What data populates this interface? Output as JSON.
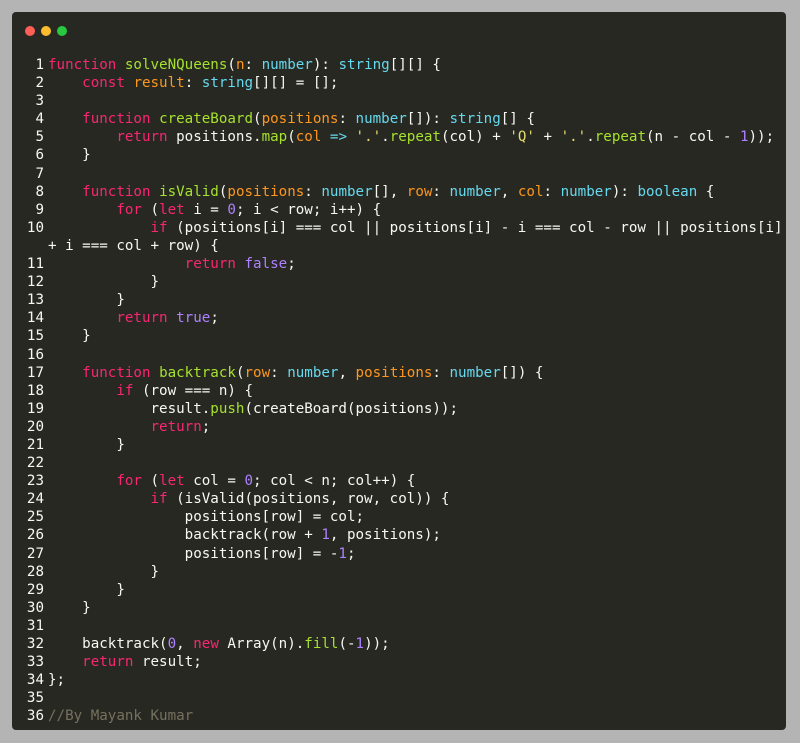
{
  "window": {
    "controls": [
      "close",
      "minimize",
      "maximize"
    ],
    "language": "typescript"
  },
  "colors": {
    "background": "#272822",
    "keyword": "#f92672",
    "function": "#a6e22e",
    "type": "#66d9ef",
    "parameter": "#fd971f",
    "string": "#e6db74",
    "number": "#ae81ff",
    "comment": "#75715e",
    "plain": "#f8f8f2"
  },
  "lines": [
    {
      "num": "1",
      "tokens": [
        [
          "k",
          "function"
        ],
        [
          "w",
          " "
        ],
        [
          "f",
          "solveNQueens"
        ],
        [
          "w",
          "("
        ],
        [
          "p",
          "n"
        ],
        [
          "w",
          ": "
        ],
        [
          "t",
          "number"
        ],
        [
          "w",
          "): "
        ],
        [
          "t",
          "string"
        ],
        [
          "w",
          "[][] {"
        ]
      ]
    },
    {
      "num": "2",
      "tokens": [
        [
          "w",
          "    "
        ],
        [
          "k",
          "const"
        ],
        [
          "w",
          " "
        ],
        [
          "p",
          "result"
        ],
        [
          "w",
          ": "
        ],
        [
          "t",
          "string"
        ],
        [
          "w",
          "[][] = [];"
        ]
      ]
    },
    {
      "num": "3",
      "tokens": []
    },
    {
      "num": "4",
      "tokens": [
        [
          "w",
          "    "
        ],
        [
          "k",
          "function"
        ],
        [
          "w",
          " "
        ],
        [
          "f",
          "createBoard"
        ],
        [
          "w",
          "("
        ],
        [
          "p",
          "positions"
        ],
        [
          "w",
          ": "
        ],
        [
          "t",
          "number"
        ],
        [
          "w",
          "[]): "
        ],
        [
          "t",
          "string"
        ],
        [
          "w",
          "[] {"
        ]
      ]
    },
    {
      "num": "5",
      "tokens": [
        [
          "w",
          "        "
        ],
        [
          "k",
          "return"
        ],
        [
          "w",
          " positions."
        ],
        [
          "f",
          "map"
        ],
        [
          "w",
          "("
        ],
        [
          "p",
          "col"
        ],
        [
          "w",
          " "
        ],
        [
          "t",
          "=>"
        ],
        [
          "w",
          " "
        ],
        [
          "s",
          "'.'"
        ],
        [
          "w",
          "."
        ],
        [
          "f",
          "repeat"
        ],
        [
          "w",
          "(col) + "
        ],
        [
          "s",
          "'Q'"
        ],
        [
          "w",
          " + "
        ],
        [
          "s",
          "'.'"
        ],
        [
          "w",
          "."
        ],
        [
          "f",
          "repeat"
        ],
        [
          "w",
          "(n - col - "
        ],
        [
          "n",
          "1"
        ],
        [
          "w",
          "));"
        ]
      ]
    },
    {
      "num": "6",
      "tokens": [
        [
          "w",
          "    }"
        ]
      ]
    },
    {
      "num": "7",
      "tokens": []
    },
    {
      "num": "8",
      "tokens": [
        [
          "w",
          "    "
        ],
        [
          "k",
          "function"
        ],
        [
          "w",
          " "
        ],
        [
          "f",
          "isValid"
        ],
        [
          "w",
          "("
        ],
        [
          "p",
          "positions"
        ],
        [
          "w",
          ": "
        ],
        [
          "t",
          "number"
        ],
        [
          "w",
          "[], "
        ],
        [
          "p",
          "row"
        ],
        [
          "w",
          ": "
        ],
        [
          "t",
          "number"
        ],
        [
          "w",
          ", "
        ],
        [
          "p",
          "col"
        ],
        [
          "w",
          ": "
        ],
        [
          "t",
          "number"
        ],
        [
          "w",
          "): "
        ],
        [
          "t",
          "boolean"
        ],
        [
          "w",
          " {"
        ]
      ]
    },
    {
      "num": "9",
      "tokens": [
        [
          "w",
          "        "
        ],
        [
          "k",
          "for"
        ],
        [
          "w",
          " ("
        ],
        [
          "k",
          "let"
        ],
        [
          "w",
          " i = "
        ],
        [
          "n",
          "0"
        ],
        [
          "w",
          "; i < row; i++) {"
        ]
      ]
    },
    {
      "num": "10",
      "tokens": [
        [
          "w",
          "            "
        ],
        [
          "k",
          "if"
        ],
        [
          "w",
          " (positions[i] === col || positions[i] - i === col - row || positions[i]"
        ]
      ]
    },
    {
      "num": "",
      "wrap": true,
      "tokens": [
        [
          "w",
          "+ i === col + row) {"
        ]
      ]
    },
    {
      "num": "11",
      "tokens": [
        [
          "w",
          "                "
        ],
        [
          "k",
          "return"
        ],
        [
          "w",
          " "
        ],
        [
          "n",
          "false"
        ],
        [
          "w",
          ";"
        ]
      ]
    },
    {
      "num": "12",
      "tokens": [
        [
          "w",
          "            }"
        ]
      ]
    },
    {
      "num": "13",
      "tokens": [
        [
          "w",
          "        }"
        ]
      ]
    },
    {
      "num": "14",
      "tokens": [
        [
          "w",
          "        "
        ],
        [
          "k",
          "return"
        ],
        [
          "w",
          " "
        ],
        [
          "n",
          "true"
        ],
        [
          "w",
          ";"
        ]
      ]
    },
    {
      "num": "15",
      "tokens": [
        [
          "w",
          "    }"
        ]
      ]
    },
    {
      "num": "16",
      "tokens": []
    },
    {
      "num": "17",
      "tokens": [
        [
          "w",
          "    "
        ],
        [
          "k",
          "function"
        ],
        [
          "w",
          " "
        ],
        [
          "f",
          "backtrack"
        ],
        [
          "w",
          "("
        ],
        [
          "p",
          "row"
        ],
        [
          "w",
          ": "
        ],
        [
          "t",
          "number"
        ],
        [
          "w",
          ", "
        ],
        [
          "p",
          "positions"
        ],
        [
          "w",
          ": "
        ],
        [
          "t",
          "number"
        ],
        [
          "w",
          "[]) {"
        ]
      ]
    },
    {
      "num": "18",
      "tokens": [
        [
          "w",
          "        "
        ],
        [
          "k",
          "if"
        ],
        [
          "w",
          " (row === n) {"
        ]
      ]
    },
    {
      "num": "19",
      "tokens": [
        [
          "w",
          "            result."
        ],
        [
          "f",
          "push"
        ],
        [
          "w",
          "(createBoard(positions));"
        ]
      ]
    },
    {
      "num": "20",
      "tokens": [
        [
          "w",
          "            "
        ],
        [
          "k",
          "return"
        ],
        [
          "w",
          ";"
        ]
      ]
    },
    {
      "num": "21",
      "tokens": [
        [
          "w",
          "        }"
        ]
      ]
    },
    {
      "num": "22",
      "tokens": []
    },
    {
      "num": "23",
      "tokens": [
        [
          "w",
          "        "
        ],
        [
          "k",
          "for"
        ],
        [
          "w",
          " ("
        ],
        [
          "k",
          "let"
        ],
        [
          "w",
          " col = "
        ],
        [
          "n",
          "0"
        ],
        [
          "w",
          "; col < n; col++) {"
        ]
      ]
    },
    {
      "num": "24",
      "tokens": [
        [
          "w",
          "            "
        ],
        [
          "k",
          "if"
        ],
        [
          "w",
          " (isValid(positions, row, col)) {"
        ]
      ]
    },
    {
      "num": "25",
      "tokens": [
        [
          "w",
          "                positions[row] = col;"
        ]
      ]
    },
    {
      "num": "26",
      "tokens": [
        [
          "w",
          "                backtrack(row + "
        ],
        [
          "n",
          "1"
        ],
        [
          "w",
          ", positions);"
        ]
      ]
    },
    {
      "num": "27",
      "tokens": [
        [
          "w",
          "                positions[row] = -"
        ],
        [
          "n",
          "1"
        ],
        [
          "w",
          ";"
        ]
      ]
    },
    {
      "num": "28",
      "tokens": [
        [
          "w",
          "            }"
        ]
      ]
    },
    {
      "num": "29",
      "tokens": [
        [
          "w",
          "        }"
        ]
      ]
    },
    {
      "num": "30",
      "tokens": [
        [
          "w",
          "    }"
        ]
      ]
    },
    {
      "num": "31",
      "tokens": []
    },
    {
      "num": "32",
      "tokens": [
        [
          "w",
          "    backtrack("
        ],
        [
          "n",
          "0"
        ],
        [
          "w",
          ", "
        ],
        [
          "k",
          "new"
        ],
        [
          "w",
          " Array(n)."
        ],
        [
          "f",
          "fill"
        ],
        [
          "w",
          "(-"
        ],
        [
          "n",
          "1"
        ],
        [
          "w",
          "));"
        ]
      ]
    },
    {
      "num": "33",
      "tokens": [
        [
          "w",
          "    "
        ],
        [
          "k",
          "return"
        ],
        [
          "w",
          " result;"
        ]
      ]
    },
    {
      "num": "34",
      "tokens": [
        [
          "w",
          "};"
        ]
      ]
    },
    {
      "num": "35",
      "tokens": []
    },
    {
      "num": "36",
      "tokens": [
        [
          "c",
          "//By Mayank Kumar"
        ]
      ]
    }
  ]
}
